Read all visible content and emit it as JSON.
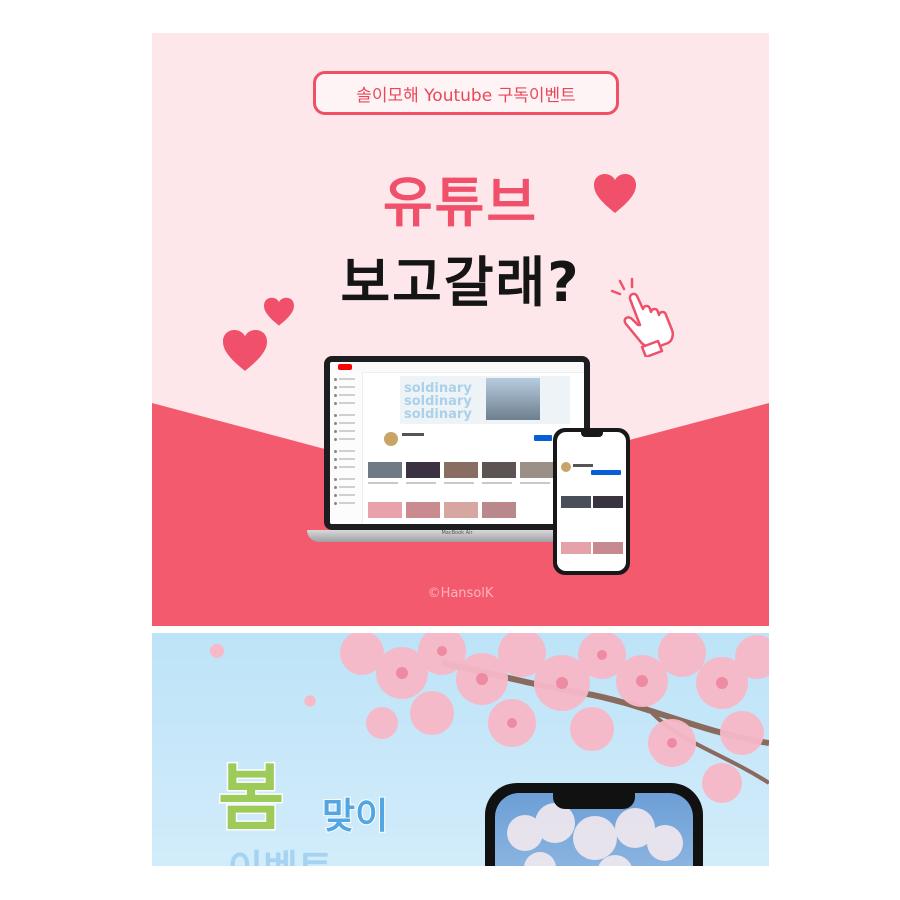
{
  "banner_top": {
    "event_label": "솔이모해 Youtube 구독이벤트",
    "headline_line1": "유튜브",
    "headline_line2": "보고갈래?",
    "copyright": "©HansolK",
    "laptop_model_label": "MacBook Air",
    "channel_banner_text": [
      "soldinary",
      "soldinary",
      "soldinary"
    ]
  },
  "banner_bottom": {
    "title_main": "봄",
    "title_sub": "맞이",
    "title_line2_partial": "이벤트"
  },
  "colors": {
    "pink_bg": "#fde7ea",
    "coral": "#f0506a",
    "sky": "#bde3f8",
    "spring_green": "#9ccb5a",
    "spring_blue": "#53a6e2"
  },
  "icons": [
    "heart-icon",
    "pointing-hand-icon",
    "youtube-logo-icon"
  ]
}
